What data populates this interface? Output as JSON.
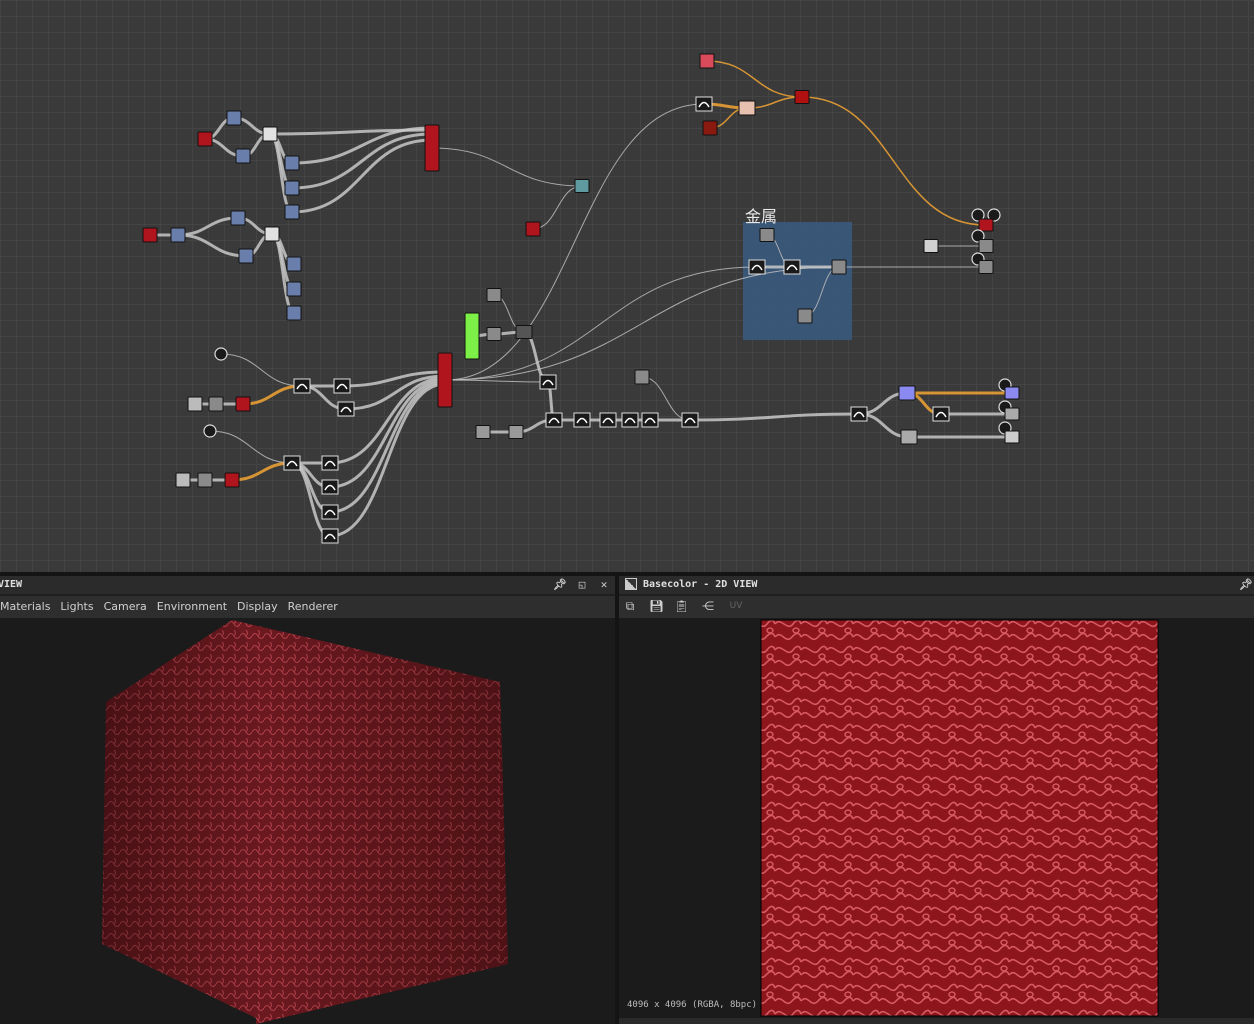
{
  "graph": {
    "frame_label": "金属",
    "colors": {
      "background": "#3a3a3a",
      "frame_fill": "#3a5a7e",
      "wire": "#c8c8c8",
      "wire_orange": "#f2a534",
      "node_red": "#b0141c",
      "node_blue": "#6a7eab",
      "node_white": "#e2e2e2",
      "node_green": "#7cf046",
      "node_teal": "#5e9aa0",
      "node_gray": "#8a8a8a",
      "node_pink": "#d94a5a"
    }
  },
  "view3d": {
    "title": "VIEW",
    "menu": [
      "Materials",
      "Lights",
      "Camera",
      "Environment",
      "Display",
      "Renderer"
    ],
    "controls": [
      "pin-icon",
      "maximize-icon",
      "close-icon"
    ],
    "material_color": "#7a1c22"
  },
  "view2d": {
    "title": "Basecolor - 2D VIEW",
    "toolbar": [
      "copy-icon",
      "save-icon",
      "paste-icon",
      "share-icon",
      "uv-icon"
    ],
    "uv_label": "UV",
    "status": "4096 x 4096 (RGBA, 8bpc)",
    "texture_base": "#8c161c",
    "texture_line": "#d85a64"
  }
}
